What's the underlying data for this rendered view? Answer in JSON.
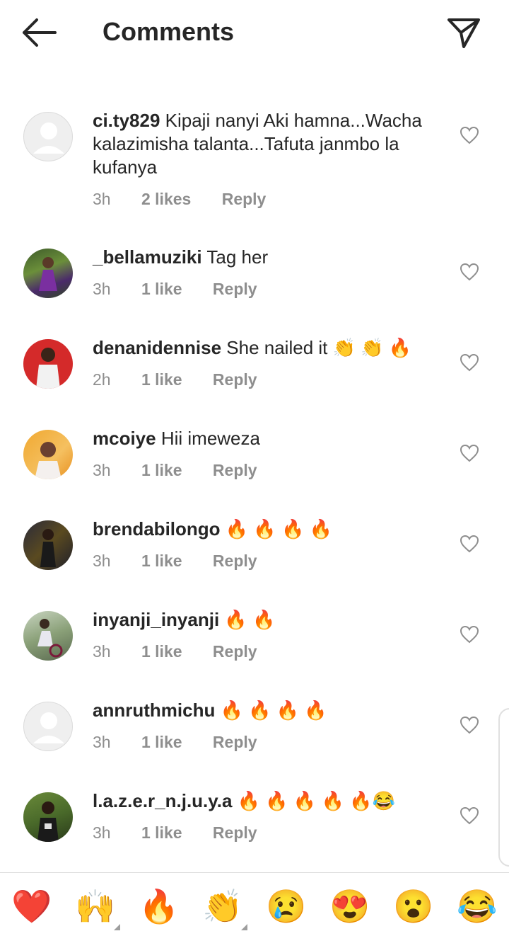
{
  "header": {
    "title": "Comments",
    "back_icon": "arrow-left-icon",
    "send_icon": "paper-plane-icon"
  },
  "comments": [
    {
      "username": "ci.ty829",
      "text": " Kipaji nanyi Aki hamna...Wacha kalazimisha talanta...Tafuta janmbo la kufanya",
      "time": "3h",
      "likes": "2 likes",
      "reply": "Reply",
      "avatar": "blank"
    },
    {
      "username": "_bellamuziki",
      "text": " Tag her",
      "time": "3h",
      "likes": "1 like",
      "reply": "Reply",
      "avatar": "photo"
    },
    {
      "username": "denanidennise",
      "text": " She nailed it 👏 👏 🔥",
      "time": "2h",
      "likes": "1 like",
      "reply": "Reply",
      "avatar": "photo"
    },
    {
      "username": "mcoiye",
      "text": " Hii imeweza",
      "time": "3h",
      "likes": "1 like",
      "reply": "Reply",
      "avatar": "photo"
    },
    {
      "username": "brendabilongo",
      "text": " 🔥 🔥 🔥 🔥",
      "time": "3h",
      "likes": "1 like",
      "reply": "Reply",
      "avatar": "photo"
    },
    {
      "username": "inyanji_inyanji",
      "text": " 🔥 🔥",
      "time": "3h",
      "likes": "1 like",
      "reply": "Reply",
      "avatar": "photo"
    },
    {
      "username": "annruthmichu",
      "text": " 🔥 🔥 🔥 🔥",
      "time": "3h",
      "likes": "1 like",
      "reply": "Reply",
      "avatar": "blank"
    },
    {
      "username": "l.a.z.e.r_n.j.u.y.a",
      "text": " 🔥 🔥 🔥 🔥 🔥😂",
      "time": "3h",
      "likes": "1 like",
      "reply": "Reply",
      "avatar": "photo"
    }
  ],
  "quick_reactions": [
    "❤️",
    "🙌",
    "🔥",
    "👏",
    "😢",
    "😍",
    "😮",
    "😂"
  ],
  "colors": {
    "text": "#262626",
    "secondary": "#8e8e8e",
    "divider": "#dbdbdb"
  }
}
